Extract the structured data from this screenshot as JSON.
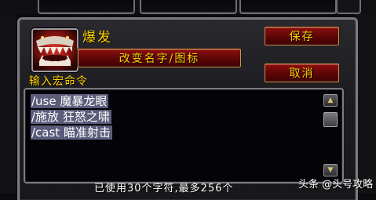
{
  "macro": {
    "name": "爆发",
    "rename_label": "改变名字/图标",
    "save_label": "保存",
    "cancel_label": "取消",
    "input_label": "输入宏命令",
    "lines": [
      "/use 魔暴龙眼",
      "/施放 狂怒之啸",
      "/cast 瞄准射击"
    ],
    "char_count_text": "已使用30个字符,最多256个",
    "icon": "beast-maw-icon"
  },
  "scrollbar": {
    "up_icon": "scroll-up-arrow-icon",
    "down_icon": "scroll-down-arrow-icon"
  },
  "watermark": {
    "text": "头条 @头号攻略"
  },
  "colors": {
    "gold_text": "#ffd200",
    "button_red": "#8c0f0f",
    "selection": "#5a5c7a"
  }
}
